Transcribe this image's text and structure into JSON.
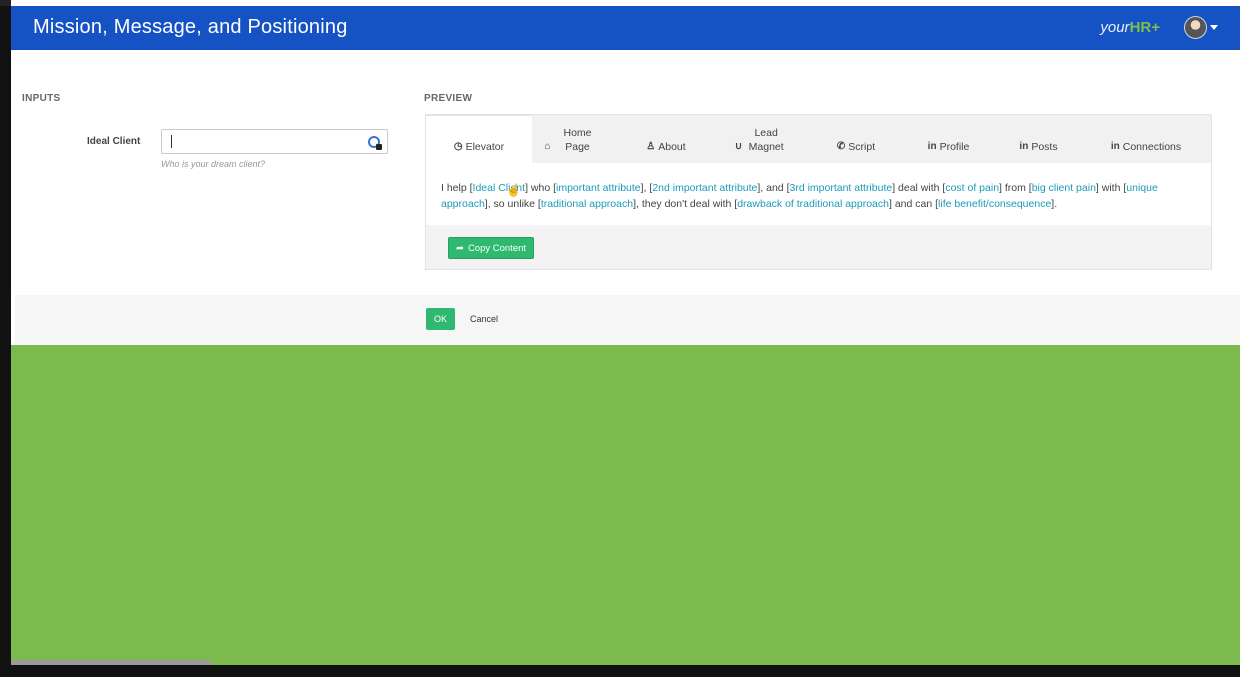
{
  "header": {
    "title": "Mission, Message, and Positioning",
    "brand_prefix": "your",
    "brand_mark": "HR+"
  },
  "inputs": {
    "section_title": "INPUTS",
    "field_label": "Ideal Client",
    "field_value": "",
    "help_text": "Who is your dream client?"
  },
  "preview": {
    "section_title": "PREVIEW",
    "tabs": [
      {
        "icon": "clock-icon",
        "label": "Elevator",
        "active": true
      },
      {
        "icon": "home-icon",
        "label": "Home Page"
      },
      {
        "icon": "user-icon",
        "label": "About"
      },
      {
        "icon": "magnet-icon",
        "label": "Lead Magnet"
      },
      {
        "icon": "phone-icon",
        "label": "Script"
      },
      {
        "icon": "linkedin-icon",
        "label": "Profile"
      },
      {
        "icon": "linkedin-icon",
        "label": "Posts"
      },
      {
        "icon": "linkedin-icon",
        "label": "Connections"
      }
    ],
    "content": {
      "t1": "I help [",
      "p1": "Ideal Client",
      "t2": "] who [",
      "p2": "important attribute",
      "t3": "], [",
      "p3": "2nd important attribute",
      "t4": "], and [",
      "p4": "3rd important attribute",
      "t5": "] deal with [",
      "p5": "cost of pain",
      "t6": "] from [",
      "p6": "big client pain",
      "t7": "] with [",
      "p7": "unique approach",
      "t8": "], so unlike [",
      "p8": "traditional approach",
      "t9": "], they don't deal with [",
      "p9": "drawback of traditional approach",
      "t10": "] and can [",
      "p10": "life benefit/consequence",
      "t11": "]."
    },
    "copy_label": "Copy Content"
  },
  "footer": {
    "ok_label": "OK",
    "cancel_label": "Cancel"
  },
  "colors": {
    "header": "#1552c4",
    "accent_green": "#2fb870",
    "background_green": "#7dba4d",
    "placeholder_link": "#1b9ab8"
  }
}
